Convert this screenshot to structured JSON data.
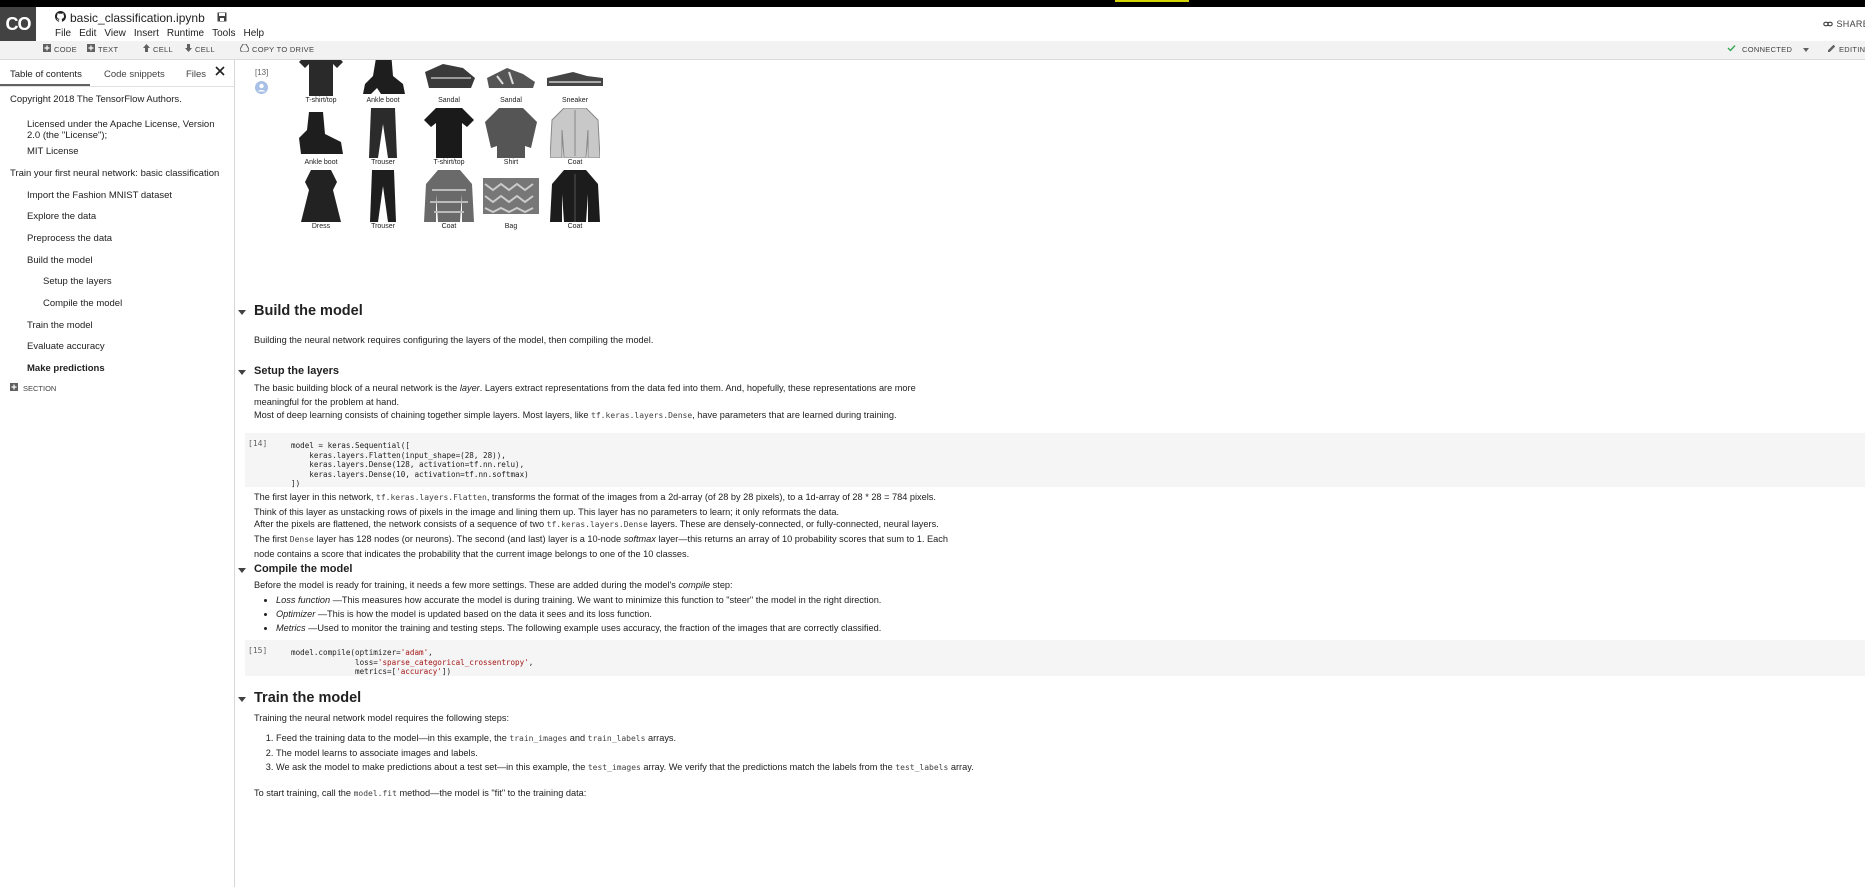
{
  "app": {
    "logo": "CO",
    "notebook_title": "basic_classification.ipynb",
    "menus": [
      "File",
      "Edit",
      "View",
      "Insert",
      "Runtime",
      "Tools",
      "Help"
    ],
    "share_label": "SHARE",
    "editing_label": "EDITING"
  },
  "toolbar": {
    "code": "CODE",
    "text": "TEXT",
    "cell_up": "CELL",
    "cell_down": "CELL",
    "copy": "COPY TO DRIVE",
    "connected": "CONNECTED"
  },
  "sidebar": {
    "tabs": [
      "Table of contents",
      "Code snippets",
      "Files"
    ],
    "toc": [
      "Copyright 2018 The TensorFlow Authors.",
      "Licensed under the Apache License, Version 2.0 (the \"License\");",
      "MIT License",
      "Train your first neural network: basic classification",
      "Import the Fashion MNIST dataset",
      "Explore the data",
      "Preprocess the data",
      "Build the model",
      "Setup the layers",
      "Compile the model",
      "Train the model",
      "Evaluate accuracy",
      "Make predictions"
    ],
    "section_label": "SECTION"
  },
  "cells": {
    "out13": "[13]",
    "c14": "[14]",
    "c15": "[15]"
  },
  "figures": {
    "row1": [
      "T-shirt/top",
      "Ankle boot",
      "Sandal",
      "Sandal",
      "Sneaker"
    ],
    "row2": [
      "Ankle boot",
      "Trouser",
      "T-shirt/top",
      "Shirt",
      "Coat"
    ],
    "row3": [
      "Dress",
      "Trouser",
      "Coat",
      "Bag",
      "Coat"
    ]
  },
  "content": {
    "build_title": "Build the model",
    "build_text": "Building the neural network requires configuring the layers of the model, then compiling the model.",
    "setup_title": "Setup the layers",
    "setup_p1a": "The basic building block of a neural network is the ",
    "setup_p1_em": "layer",
    "setup_p1b": ". Layers extract representations from the data fed into them. And, hopefully, these representations are more meaningful for the problem at hand.",
    "setup_p2a": "Most of deep learning consists of chaining together simple layers. Most layers, like ",
    "setup_p2_code": "tf.keras.layers.Dense",
    "setup_p2b": ", have parameters that are learned during training.",
    "code14": "model = keras.Sequential([\n    keras.layers.Flatten(input_shape=(28, 28)),\n    keras.layers.Dense(128, activation=tf.nn.relu),\n    keras.layers.Dense(10, activation=tf.nn.softmax)\n])",
    "flat_a": "The first layer in this network, ",
    "flat_code": "tf.keras.layers.Flatten",
    "flat_b": ", transforms the format of the images from a 2d-array (of 28 by 28 pixels), to a 1d-array of 28 * 28 = 784 pixels. Think of this layer as unstacking rows of pixels in the image and lining them up. This layer has no parameters to learn; it only reformats the data.",
    "dense_a": "After the pixels are flattened, the network consists of a sequence of two ",
    "dense_code1": "tf.keras.layers.Dense",
    "dense_b": " layers. These are densely-connected, or fully-connected, neural layers. The first ",
    "dense_code2": "Dense",
    "dense_c": " layer has 128 nodes (or neurons). The second (and last) layer is a 10-node ",
    "dense_em": "softmax",
    "dense_d": " layer—this returns an array of 10 probability scores that sum to 1. Each node contains a score that indicates the probability that the current image belongs to one of the 10 classes.",
    "compile_title": "Compile the model",
    "compile_a": "Before the model is ready for training, it needs a few more settings. These are added during the model's ",
    "compile_em": "compile",
    "compile_b": " step:",
    "bullets": [
      {
        "em": "Loss function",
        "text": " —This measures how accurate the model is during training. We want to minimize this function to \"steer\" the model in the right direction."
      },
      {
        "em": "Optimizer",
        "text": " —This is how the model is updated based on the data it sees and its loss function."
      },
      {
        "em": "Metrics",
        "text": " —Used to monitor the training and testing steps. The following example uses accuracy, the fraction of the images that are correctly classified."
      }
    ],
    "code15_a": "model.compile(optimizer=",
    "code15_s1": "'adam'",
    "code15_b": ",\n              loss=",
    "code15_s2": "'sparse_categorical_crossentropy'",
    "code15_c": ",\n              metrics=[",
    "code15_s3": "'accuracy'",
    "code15_d": "])",
    "train_title": "Train the model",
    "train_text": "Training the neural network model requires the following steps:",
    "steps": {
      "s1a": "Feed the training data to the model—in this example, the ",
      "s1c1": "train_images",
      "s1b": " and ",
      "s1c2": "train_labels",
      "s1d": " arrays.",
      "s2": "The model learns to associate images and labels.",
      "s3a": "We ask the model to make predictions about a test set—in this example, the ",
      "s3c1": "test_images",
      "s3b": " array. We verify that the predictions match the labels from the ",
      "s3c2": "test_labels",
      "s3d": " array."
    },
    "fit_a": "To start training, call the ",
    "fit_code": "model.fit",
    "fit_b": " method—the model is \"fit\" to the training data:"
  }
}
